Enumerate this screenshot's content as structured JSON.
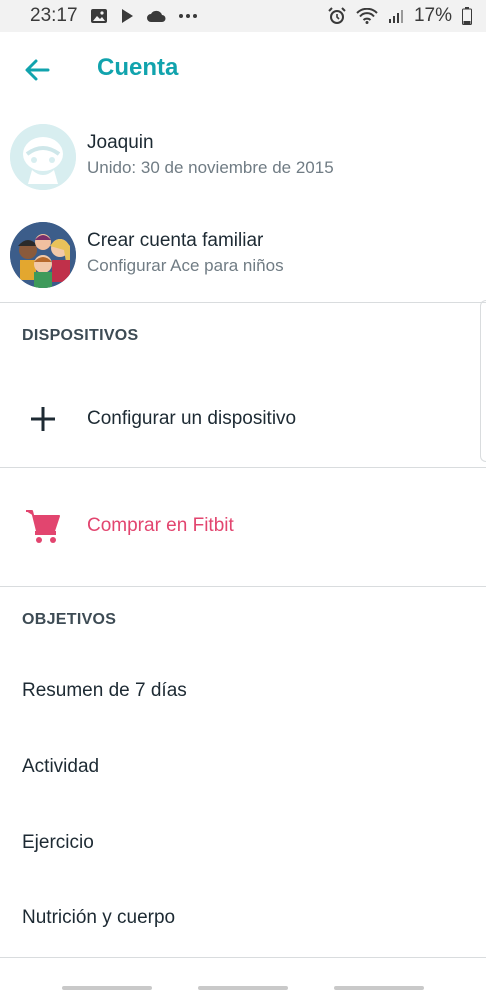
{
  "status_bar": {
    "time": "23:17",
    "battery": "17%"
  },
  "header": {
    "title": "Cuenta"
  },
  "account": {
    "user": {
      "name": "Joaquin",
      "joined": "Unido: 30 de noviembre de 2015"
    },
    "family": {
      "title": "Crear cuenta familiar",
      "subtitle": "Configurar Ace para niños"
    }
  },
  "devices": {
    "section_label": "DISPOSITIVOS",
    "setup_label": "Configurar un dispositivo"
  },
  "shop": {
    "label": "Comprar en Fitbit",
    "color": "#e2456f"
  },
  "goals": {
    "section_label": "OBJETIVOS",
    "items": [
      {
        "label": "Resumen de 7 días"
      },
      {
        "label": "Actividad"
      },
      {
        "label": "Ejercicio"
      },
      {
        "label": "Nutrición y cuerpo"
      }
    ]
  },
  "colors": {
    "accent": "#11a3ad",
    "text": "#1d2a33",
    "muted": "#707c84"
  }
}
